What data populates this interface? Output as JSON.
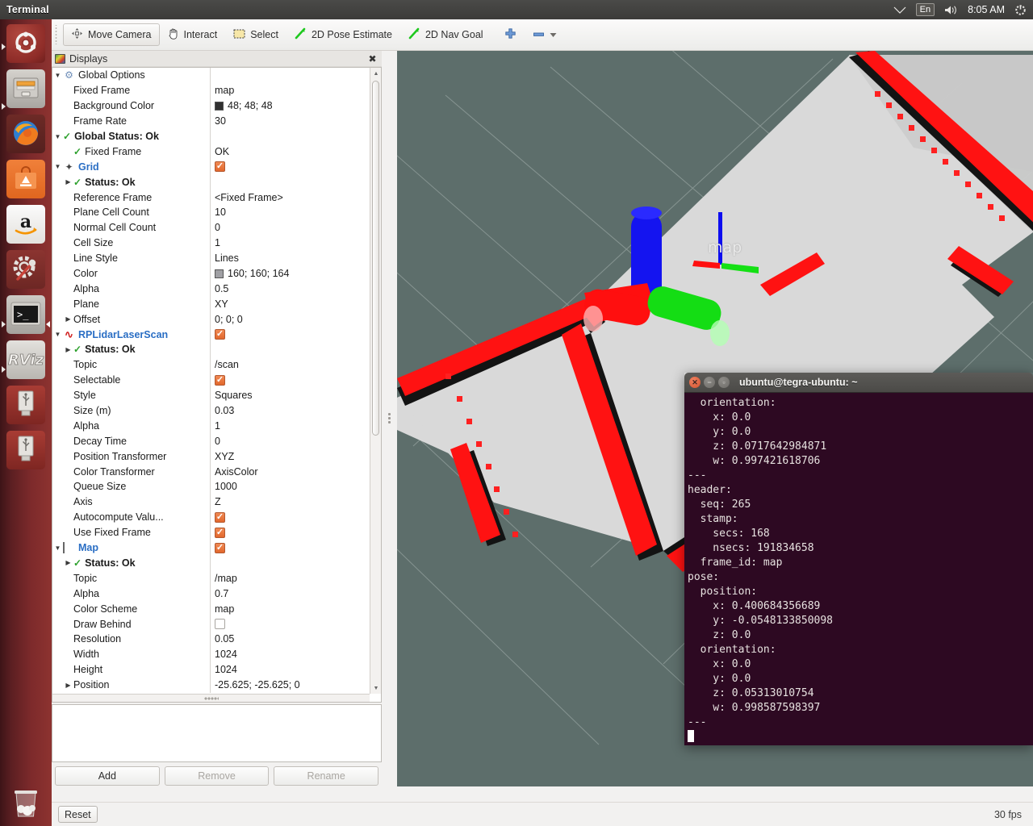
{
  "top_panel": {
    "app_name": "Terminal",
    "indicators": {
      "network_icon": "wifi-icon",
      "keyboard_label": "En",
      "volume_icon": "volume-icon",
      "clock": "8:05 AM",
      "session_icon": "gear-power-icon"
    }
  },
  "launcher": {
    "items": [
      {
        "name": "ubuntu-dash",
        "label": "Ubuntu Dash",
        "icon": "ubuntu-logo-icon",
        "running": false,
        "focused": false
      },
      {
        "name": "files",
        "label": "Files",
        "icon": "file-manager-icon",
        "running": true,
        "focused": false
      },
      {
        "name": "firefox",
        "label": "Firefox",
        "icon": "firefox-icon",
        "running": false,
        "focused": false
      },
      {
        "name": "software-center",
        "label": "Ubuntu Software Center",
        "icon": "software-center-icon",
        "running": false,
        "focused": false
      },
      {
        "name": "amazon",
        "label": "Amazon",
        "icon": "amazon-icon",
        "running": false,
        "focused": false
      },
      {
        "name": "system-settings",
        "label": "System Settings",
        "icon": "gear-wrench-icon",
        "running": false,
        "focused": false
      },
      {
        "name": "terminal",
        "label": "Terminal",
        "icon": "terminal-icon",
        "running": true,
        "focused": true
      },
      {
        "name": "rviz",
        "label": "RViz",
        "icon": "rviz-icon",
        "running": true,
        "focused": false
      },
      {
        "name": "usb-drive-1",
        "label": "USB Drive",
        "icon": "usb-drive-icon",
        "running": false,
        "focused": false
      },
      {
        "name": "usb-drive-2",
        "label": "USB Drive",
        "icon": "usb-drive-icon",
        "running": false,
        "focused": false
      },
      {
        "name": "trash",
        "label": "Trash",
        "icon": "trash-icon",
        "running": false,
        "focused": false
      }
    ]
  },
  "toolbar": {
    "tools": [
      {
        "name": "move-camera",
        "label": "Move Camera",
        "icon": "move-camera-icon",
        "active": true
      },
      {
        "name": "interact",
        "label": "Interact",
        "icon": "hand-icon",
        "active": false
      },
      {
        "name": "select",
        "label": "Select",
        "icon": "select-rect-icon",
        "active": false
      },
      {
        "name": "pose-estimate",
        "label": "2D Pose Estimate",
        "icon": "green-arrow-icon",
        "active": false
      },
      {
        "name": "nav-goal",
        "label": "2D Nav Goal",
        "icon": "green-arrow-icon",
        "active": false
      }
    ],
    "add_tool_icon": "plus-icon",
    "remove_tool_icon": "minus-icon",
    "remove_tool_menu_icon": "chevron-down-icon"
  },
  "displays_panel": {
    "title": "Displays",
    "title_icon": "display-monitor-icon",
    "close_icon": "close-icon",
    "rows": [
      {
        "indent": 0,
        "expander": "down",
        "icon": "gear-icon",
        "name": "Global Options",
        "value": "",
        "style": "plain"
      },
      {
        "indent": 1,
        "expander": "none",
        "icon": "",
        "name": "Fixed Frame",
        "value": "map",
        "style": "plain"
      },
      {
        "indent": 1,
        "expander": "none",
        "icon": "",
        "name": "Background Color",
        "value": "48; 48; 48",
        "style": "plain",
        "swatch": "dark"
      },
      {
        "indent": 1,
        "expander": "none",
        "icon": "",
        "name": "Frame Rate",
        "value": "30",
        "style": "plain"
      },
      {
        "indent": 0,
        "expander": "down",
        "icon": "check",
        "name": "Global Status: Ok",
        "value": "",
        "style": "bold"
      },
      {
        "indent": 1,
        "expander": "none",
        "icon": "check",
        "name": "Fixed Frame",
        "value": "OK",
        "style": "plain"
      },
      {
        "indent": 0,
        "expander": "down",
        "icon": "grid-icon",
        "name": "Grid",
        "value": "",
        "style": "category",
        "checkbox": "checked"
      },
      {
        "indent": 1,
        "expander": "right",
        "icon": "check",
        "name": "Status: Ok",
        "value": "",
        "style": "bold"
      },
      {
        "indent": 1,
        "expander": "none",
        "icon": "",
        "name": "Reference Frame",
        "value": "<Fixed Frame>",
        "style": "plain"
      },
      {
        "indent": 1,
        "expander": "none",
        "icon": "",
        "name": "Plane Cell Count",
        "value": "10",
        "style": "plain"
      },
      {
        "indent": 1,
        "expander": "none",
        "icon": "",
        "name": "Normal Cell Count",
        "value": "0",
        "style": "plain"
      },
      {
        "indent": 1,
        "expander": "none",
        "icon": "",
        "name": "Cell Size",
        "value": "1",
        "style": "plain"
      },
      {
        "indent": 1,
        "expander": "none",
        "icon": "",
        "name": "Line Style",
        "value": "Lines",
        "style": "plain"
      },
      {
        "indent": 1,
        "expander": "none",
        "icon": "",
        "name": "Color",
        "value": "160; 160; 164",
        "style": "plain",
        "swatch": "gray"
      },
      {
        "indent": 1,
        "expander": "none",
        "icon": "",
        "name": "Alpha",
        "value": "0.5",
        "style": "plain"
      },
      {
        "indent": 1,
        "expander": "none",
        "icon": "",
        "name": "Plane",
        "value": "XY",
        "style": "plain"
      },
      {
        "indent": 1,
        "expander": "right",
        "icon": "",
        "name": "Offset",
        "value": "0; 0; 0",
        "style": "plain"
      },
      {
        "indent": 0,
        "expander": "down",
        "icon": "laserscan-icon",
        "name": "RPLidarLaserScan",
        "value": "",
        "style": "category",
        "checkbox": "checked"
      },
      {
        "indent": 1,
        "expander": "right",
        "icon": "check",
        "name": "Status: Ok",
        "value": "",
        "style": "bold"
      },
      {
        "indent": 1,
        "expander": "none",
        "icon": "",
        "name": "Topic",
        "value": "/scan",
        "style": "plain"
      },
      {
        "indent": 1,
        "expander": "none",
        "icon": "",
        "name": "Selectable",
        "value": "",
        "style": "plain",
        "checkbox": "checked"
      },
      {
        "indent": 1,
        "expander": "none",
        "icon": "",
        "name": "Style",
        "value": "Squares",
        "style": "plain"
      },
      {
        "indent": 1,
        "expander": "none",
        "icon": "",
        "name": "Size (m)",
        "value": "0.03",
        "style": "plain"
      },
      {
        "indent": 1,
        "expander": "none",
        "icon": "",
        "name": "Alpha",
        "value": "1",
        "style": "plain"
      },
      {
        "indent": 1,
        "expander": "none",
        "icon": "",
        "name": "Decay Time",
        "value": "0",
        "style": "plain"
      },
      {
        "indent": 1,
        "expander": "none",
        "icon": "",
        "name": "Position Transformer",
        "value": "XYZ",
        "style": "plain"
      },
      {
        "indent": 1,
        "expander": "none",
        "icon": "",
        "name": "Color Transformer",
        "value": "AxisColor",
        "style": "plain"
      },
      {
        "indent": 1,
        "expander": "none",
        "icon": "",
        "name": "Queue Size",
        "value": "1000",
        "style": "plain"
      },
      {
        "indent": 1,
        "expander": "none",
        "icon": "",
        "name": "Axis",
        "value": "Z",
        "style": "plain"
      },
      {
        "indent": 1,
        "expander": "none",
        "icon": "",
        "name": "Autocompute Valu...",
        "value": "",
        "style": "plain",
        "checkbox": "checked"
      },
      {
        "indent": 1,
        "expander": "none",
        "icon": "",
        "name": "Use Fixed Frame",
        "value": "",
        "style": "plain",
        "checkbox": "checked"
      },
      {
        "indent": 0,
        "expander": "down",
        "icon": "map-icon",
        "name": "Map",
        "value": "",
        "style": "category",
        "checkbox": "checked"
      },
      {
        "indent": 1,
        "expander": "right",
        "icon": "check",
        "name": "Status: Ok",
        "value": "",
        "style": "bold"
      },
      {
        "indent": 1,
        "expander": "none",
        "icon": "",
        "name": "Topic",
        "value": "/map",
        "style": "plain"
      },
      {
        "indent": 1,
        "expander": "none",
        "icon": "",
        "name": "Alpha",
        "value": "0.7",
        "style": "plain"
      },
      {
        "indent": 1,
        "expander": "none",
        "icon": "",
        "name": "Color Scheme",
        "value": "map",
        "style": "plain"
      },
      {
        "indent": 1,
        "expander": "none",
        "icon": "",
        "name": "Draw Behind",
        "value": "",
        "style": "plain",
        "checkbox": "unchecked"
      },
      {
        "indent": 1,
        "expander": "none",
        "icon": "",
        "name": "Resolution",
        "value": "0.05",
        "style": "plain"
      },
      {
        "indent": 1,
        "expander": "none",
        "icon": "",
        "name": "Width",
        "value": "1024",
        "style": "plain"
      },
      {
        "indent": 1,
        "expander": "none",
        "icon": "",
        "name": "Height",
        "value": "1024",
        "style": "plain"
      },
      {
        "indent": 1,
        "expander": "right",
        "icon": "",
        "name": "Position",
        "value": "-25.625; -25.625; 0",
        "style": "plain"
      }
    ],
    "buttons": {
      "add": "Add",
      "remove": "Remove",
      "rename": "Rename"
    }
  },
  "view3d": {
    "frame_label": "map",
    "background_color": "#5d6e6b",
    "grid_color": "#bec8c6",
    "map_free_color": "#d8d8d8",
    "map_occupied_color": "#141414",
    "scan_color": "#ff1414",
    "axis_x_color": "#ff0000",
    "axis_y_color": "#00e000",
    "axis_z_color": "#0000ff"
  },
  "status_bar": {
    "reset_label": "Reset",
    "fps": "30 fps"
  },
  "terminal": {
    "title": "ubuntu@tegra-ubuntu: ~",
    "close_icon": "close-icon",
    "minimize_icon": "minimize-icon",
    "maximize_icon": "maximize-icon",
    "lines": [
      "  orientation:",
      "    x: 0.0",
      "    y: 0.0",
      "    z: 0.0717642984871",
      "    w: 0.997421618706",
      "---",
      "header:",
      "  seq: 265",
      "  stamp:",
      "    secs: 168",
      "    nsecs: 191834658",
      "  frame_id: map",
      "pose:",
      "  position:",
      "    x: 0.400684356689",
      "    y: -0.0548133850098",
      "    z: 0.0",
      "  orientation:",
      "    x: 0.0",
      "    y: 0.0",
      "    z: 0.05313010754",
      "    w: 0.998587598397",
      "---"
    ]
  }
}
